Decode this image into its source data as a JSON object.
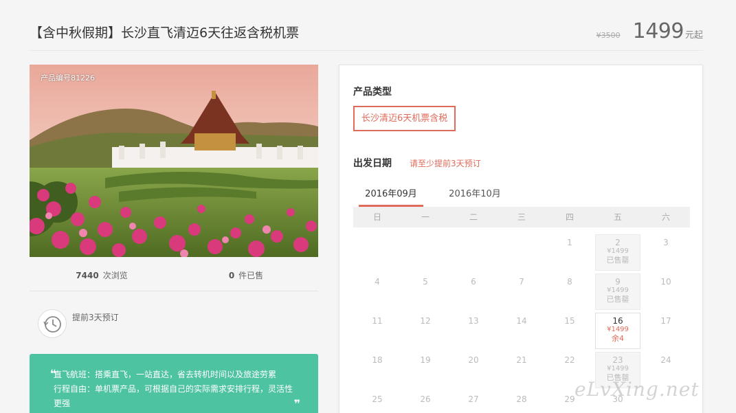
{
  "product": {
    "title": "【含中秋假期】长沙直飞清迈6天往返含税机票",
    "original_price": "¥3500",
    "price": "1499",
    "price_unit": "元起",
    "code_label": "产品编号81226"
  },
  "stats": {
    "views_num": "7440",
    "views_label": "次浏览",
    "sold_num": "0",
    "sold_label": "件已售"
  },
  "advance": {
    "text": "提前3天预订",
    "icon": "clock-history-icon"
  },
  "note": {
    "line1": "直飞航班：搭乘直飞，一站直达，省去转机时间以及旅途劳累",
    "line2": "行程自由：单机票产品，可根据自己的实际需求安排行程，灵活性更强",
    "open_quote": "❝",
    "close_quote": "❞"
  },
  "booking": {
    "type_heading": "产品类型",
    "type_option": "长沙清迈6天机票含税",
    "date_heading": "出发日期",
    "date_hint": "请至少提前3天预订",
    "tabs": [
      "2016年09月",
      "2016年10月"
    ],
    "active_tab": 0,
    "weekdays": [
      "日",
      "一",
      "二",
      "三",
      "四",
      "五",
      "六"
    ],
    "days": [
      {
        "day": "",
        "price": "",
        "status": ""
      },
      {
        "day": "",
        "price": "",
        "status": ""
      },
      {
        "day": "",
        "price": "",
        "status": ""
      },
      {
        "day": "",
        "price": "",
        "status": ""
      },
      {
        "day": "1",
        "price": "",
        "status": ""
      },
      {
        "day": "2",
        "price": "¥1499",
        "status": "已售罄"
      },
      {
        "day": "3",
        "price": "",
        "status": ""
      },
      {
        "day": "4",
        "price": "",
        "status": ""
      },
      {
        "day": "5",
        "price": "",
        "status": ""
      },
      {
        "day": "6",
        "price": "",
        "status": ""
      },
      {
        "day": "7",
        "price": "",
        "status": ""
      },
      {
        "day": "8",
        "price": "",
        "status": ""
      },
      {
        "day": "9",
        "price": "¥1499",
        "status": "已售罄"
      },
      {
        "day": "10",
        "price": "",
        "status": ""
      },
      {
        "day": "11",
        "price": "",
        "status": ""
      },
      {
        "day": "12",
        "price": "",
        "status": ""
      },
      {
        "day": "13",
        "price": "",
        "status": ""
      },
      {
        "day": "14",
        "price": "",
        "status": ""
      },
      {
        "day": "15",
        "price": "",
        "status": ""
      },
      {
        "day": "16",
        "price": "¥1499",
        "status": "余4",
        "available": true
      },
      {
        "day": "17",
        "price": "",
        "status": ""
      },
      {
        "day": "18",
        "price": "",
        "status": ""
      },
      {
        "day": "19",
        "price": "",
        "status": ""
      },
      {
        "day": "20",
        "price": "",
        "status": ""
      },
      {
        "day": "21",
        "price": "",
        "status": ""
      },
      {
        "day": "22",
        "price": "",
        "status": ""
      },
      {
        "day": "23",
        "price": "¥1499",
        "status": "已售罄"
      },
      {
        "day": "24",
        "price": "",
        "status": ""
      },
      {
        "day": "25",
        "price": "",
        "status": ""
      },
      {
        "day": "26",
        "price": "",
        "status": ""
      },
      {
        "day": "27",
        "price": "",
        "status": ""
      },
      {
        "day": "28",
        "price": "",
        "status": ""
      },
      {
        "day": "29",
        "price": "",
        "status": ""
      },
      {
        "day": "30",
        "price": "",
        "status": ""
      }
    ]
  },
  "watermark": "eLvXing.net",
  "colors": {
    "accent": "#e06b5a",
    "note_bg": "#4dc3a1"
  }
}
